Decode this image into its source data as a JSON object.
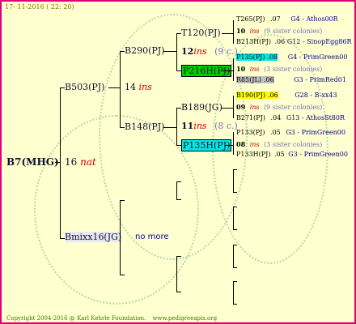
{
  "header": {
    "date": "17- 11-2016 ( 22: 20)"
  },
  "footer": {
    "copyright": "Copyright 2004-2016 @ Karl Kehrle Foundation.",
    "url": "www.pedigreeapis.org"
  },
  "root": {
    "id": "B7(MHG)",
    "gen": "16",
    "type": "nat"
  },
  "gen1": {
    "father": {
      "id": "B503(PJ)",
      "gen": "14",
      "type": "ins"
    },
    "mother": {
      "id": "Bmixx16(JG)",
      "note": "no more"
    }
  },
  "gen2": [
    {
      "id": "B290(PJ)"
    },
    {
      "id": "B148(PJ)"
    }
  ],
  "gen3": [
    {
      "father": "T120(PJ)",
      "gen": "12",
      "type": "ins",
      "count": "(9 c.)",
      "mother": "P216H(PJ)",
      "mother_color": "#00d000"
    },
    {
      "father": "B189(JG)",
      "gen": "11",
      "type": "ins",
      "count": "(8 c.)",
      "mother": "P135H(PJ)",
      "mother_color": "#00e8e8"
    }
  ],
  "gen4": [
    {
      "father": "T265(PJ)",
      "f_val": ".07",
      "f_src": "G4 - Athos00R",
      "gen": "10",
      "type": "ins",
      "colonies": "(9 sister colonies)",
      "mother": "B213H(PJ)",
      "m_val": ".06",
      "m_src": "G12 - SinopEgg86R",
      "f_hl": "",
      "m_hl": ""
    },
    {
      "father": "P135(PJ)",
      "f_val": ".08",
      "f_src": "G4 - PrimGreen00",
      "gen": "10",
      "type": "ins",
      "colonies": "(3 sister colonies)",
      "mother": "R85(JL)",
      "m_val": ".06",
      "m_src": "G3 - PrimRed01",
      "f_hl": "#00e8e8",
      "m_hl": "#c0c0c0"
    },
    {
      "father": "B190(PJ)",
      "f_val": ".06",
      "f_src": "G28 - B-xx43",
      "gen": "09",
      "type": "ins",
      "colonies": "(9 sister colonies)",
      "mother": "B271(PJ)",
      "m_val": ".04",
      "m_src": "G13 - AthosSt80R",
      "f_hl": "#ffff00",
      "m_hl": ""
    },
    {
      "father": "P133(PJ)",
      "f_val": ".05",
      "f_src": "G3 - PrimGreen00",
      "gen": "08",
      "type": "ins",
      "colonies": "(3 sister colonies)",
      "mother": "P133H(PJ)",
      "m_val": ".05",
      "m_src": "G3 - PrimGreen00",
      "f_hl": "",
      "m_hl": ""
    }
  ]
}
